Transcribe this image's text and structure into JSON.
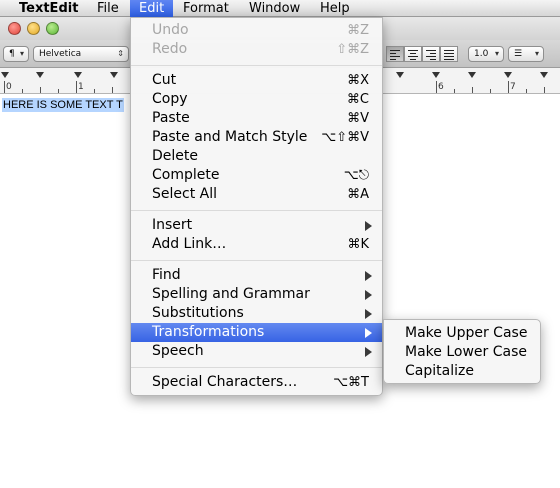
{
  "menubar": {
    "app": "TextEdit",
    "items": [
      "File",
      "Edit",
      "Format",
      "Window",
      "Help"
    ]
  },
  "toolbar": {
    "paragraph_style": "¶",
    "font": "Helvetica",
    "line_spacing": "1.0",
    "list": "☰"
  },
  "ruler": {
    "labels": [
      "0",
      "1",
      "6",
      "7"
    ]
  },
  "document": {
    "text": "HERE IS SOME TEXT T"
  },
  "edit_menu": {
    "undo": {
      "label": "Undo",
      "shortcut": "⌘Z"
    },
    "redo": {
      "label": "Redo",
      "shortcut": "⇧⌘Z"
    },
    "cut": {
      "label": "Cut",
      "shortcut": "⌘X"
    },
    "copy": {
      "label": "Copy",
      "shortcut": "⌘C"
    },
    "paste": {
      "label": "Paste",
      "shortcut": "⌘V"
    },
    "paste_match": {
      "label": "Paste and Match Style",
      "shortcut": "⌥⇧⌘V"
    },
    "delete": {
      "label": "Delete"
    },
    "complete": {
      "label": "Complete",
      "shortcut": "⌥⎋"
    },
    "select_all": {
      "label": "Select All",
      "shortcut": "⌘A"
    },
    "insert": {
      "label": "Insert"
    },
    "add_link": {
      "label": "Add Link…",
      "shortcut": "⌘K"
    },
    "find": {
      "label": "Find"
    },
    "spelling": {
      "label": "Spelling and Grammar"
    },
    "substitutions": {
      "label": "Substitutions"
    },
    "transformations": {
      "label": "Transformations"
    },
    "speech": {
      "label": "Speech"
    },
    "special_chars": {
      "label": "Special Characters…",
      "shortcut": "⌥⌘T"
    }
  },
  "transformations_menu": {
    "upper": "Make Upper Case",
    "lower": "Make Lower Case",
    "capitalize": "Capitalize"
  },
  "colors": {
    "highlight": "#3763e4",
    "selection": "#b5d5ff"
  }
}
